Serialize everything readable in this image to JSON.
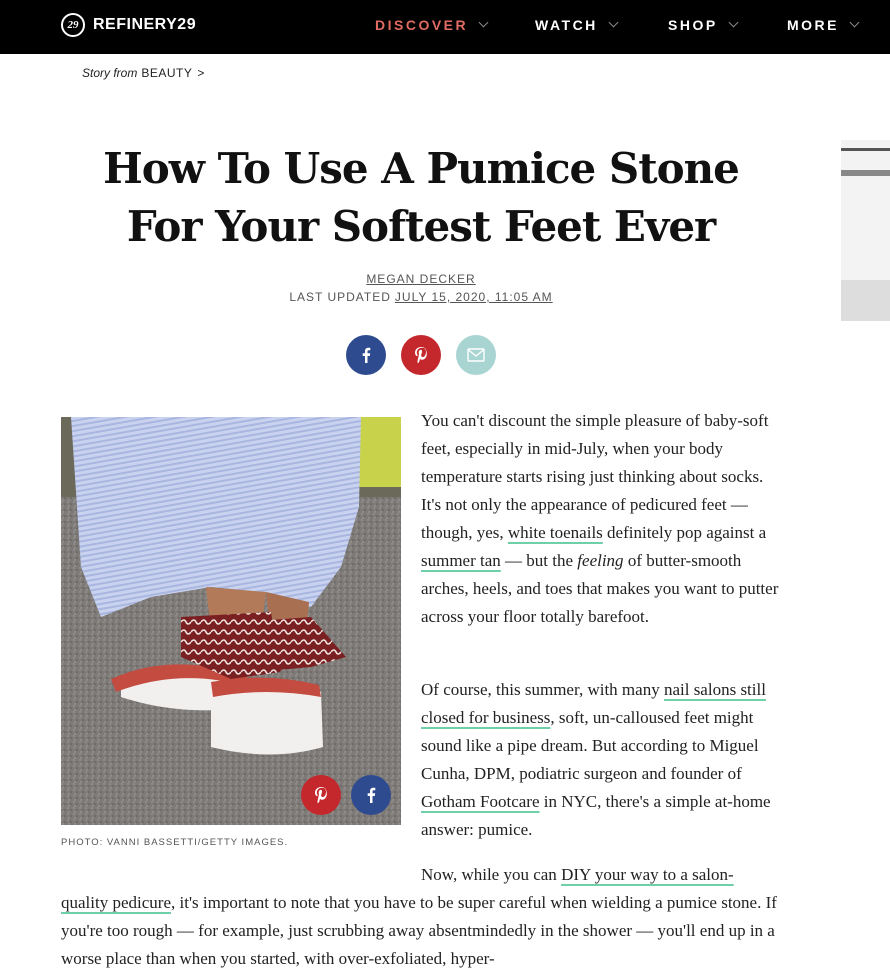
{
  "header": {
    "logo_mark": "29",
    "logo_text": "REFINERY29",
    "nav": [
      {
        "label": "DISCOVER",
        "active": true
      },
      {
        "label": "WATCH"
      },
      {
        "label": "SHOP"
      },
      {
        "label": "MORE"
      }
    ]
  },
  "breadcrumb": {
    "prefix": "Story from",
    "section": "BEAUTY",
    "arrow": ">"
  },
  "article": {
    "title": "How To Use A Pumice Stone For Your Softest Feet Ever",
    "author": "MEGAN DECKER",
    "updated_label": "LAST UPDATED",
    "updated_date": "JULY 15, 2020, 11:05 AM",
    "share_icons": [
      "facebook-icon",
      "pinterest-icon",
      "email-icon"
    ],
    "photo_caption": "PHOTO: VANNI BASSETTI/GETTY IMAGES.",
    "p1": {
      "t1": "You can't discount the simple pleasure of baby-soft feet, especially in mid-July, when your body temperature starts rising just thinking about socks. It's not only the appearance of pedicured feet — though, yes, ",
      "link1": "white toenails",
      "t2": " definitely pop against a ",
      "link2": "summer tan",
      "t3": " — but the ",
      "em": "feeling",
      "t4": " of butter-smooth arches, heels, and toes that makes you want to putter across your floor totally barefoot."
    },
    "p2": {
      "t1": "Of course, this summer, with many ",
      "link1": "nail salons still closed for business",
      "t2": ", soft, un-calloused feet might sound like a pipe dream. But according to Miguel Cunha, DPM, podiatric surgeon and founder of ",
      "link2": "Gotham Footcare",
      "t3": " in NYC, there's a simple at-home answer: pumice."
    },
    "p3": {
      "t1": "Now, while you can ",
      "link1a": "DIY your way to a salon-",
      "link1b": "quality pedicure",
      "t2": ", it's important to note that you have to be super careful when wielding a pumice stone. If you're too rough — for example, just scrubbing away absentmindedly in the shower — you'll end up in a worse place than when you started, with over-exfoliated, hyper-"
    }
  },
  "colors": {
    "accent": "#e06c63",
    "facebook": "#2f4b8f",
    "pinterest": "#c4282c",
    "email": "#a8d4d2",
    "link_underline": "#6fcfa6"
  }
}
